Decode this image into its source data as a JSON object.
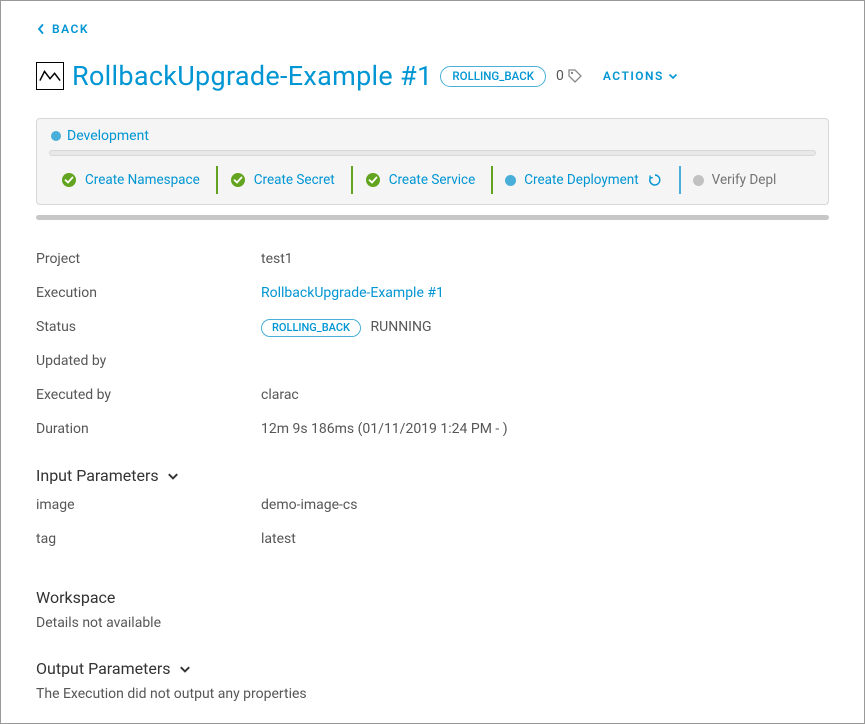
{
  "header": {
    "back_label": "BACK",
    "title": "RollbackUpgrade-Example #1",
    "status_badge": "ROLLING_BACK",
    "tag_count": "0",
    "actions_label": "ACTIONS"
  },
  "stage": {
    "name": "Development",
    "tasks": [
      {
        "label": "Create Namespace",
        "state": "done"
      },
      {
        "label": "Create Secret",
        "state": "done"
      },
      {
        "label": "Create Service",
        "state": "done"
      },
      {
        "label": "Create Deployment",
        "state": "running"
      },
      {
        "label": "Verify Depl",
        "state": "pending"
      }
    ]
  },
  "details": {
    "project": {
      "label": "Project",
      "value": "test1"
    },
    "execution": {
      "label": "Execution",
      "value": "RollbackUpgrade-Example #1"
    },
    "status": {
      "label": "Status",
      "badge": "ROLLING_BACK",
      "text": "RUNNING"
    },
    "updated_by": {
      "label": "Updated by",
      "value": ""
    },
    "executed_by": {
      "label": "Executed by",
      "value": "clarac"
    },
    "duration": {
      "label": "Duration",
      "value": "12m 9s 186ms (01/11/2019 1:24 PM - )"
    }
  },
  "input_params": {
    "heading": "Input Parameters",
    "rows": [
      {
        "k": "image",
        "v": "demo-image-cs"
      },
      {
        "k": "tag",
        "v": "latest"
      }
    ]
  },
  "workspace": {
    "heading": "Workspace",
    "sub": "Details not available"
  },
  "output_params": {
    "heading": "Output Parameters",
    "sub": "The Execution did not output any properties"
  }
}
